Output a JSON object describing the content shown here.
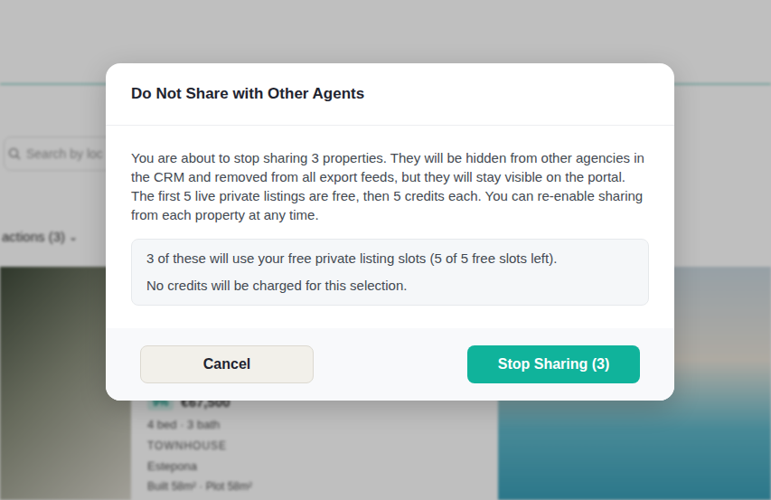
{
  "background": {
    "search_placeholder": "Search by loc",
    "actions_label": "actions (3)",
    "actions_icon": "⌄",
    "card": {
      "badge": "9%",
      "price": "€67,500",
      "specs": "4 bed · 3 bath",
      "type": "TOWNHOUSE",
      "location": "Estepona",
      "size": "Built 58m² · Plot 58m²"
    }
  },
  "dialog": {
    "title": "Do Not Share with Other Agents",
    "message": "You are about to stop sharing 3 properties. They will be hidden from other agencies in the CRM and removed from all export feeds, but they will stay visible on the portal. The first 5 live private listings are free, then 5 credits each. You can re-enable sharing from each property at any time.",
    "summary": [
      "3 of these will use your free private listing slots (5 of 5 free slots left).",
      "No credits will be charged for this selection."
    ],
    "buttons": [
      {
        "label": "Cancel",
        "kind": "secondary"
      },
      {
        "label": "Stop Sharing (3)",
        "kind": "primary"
      }
    ]
  }
}
